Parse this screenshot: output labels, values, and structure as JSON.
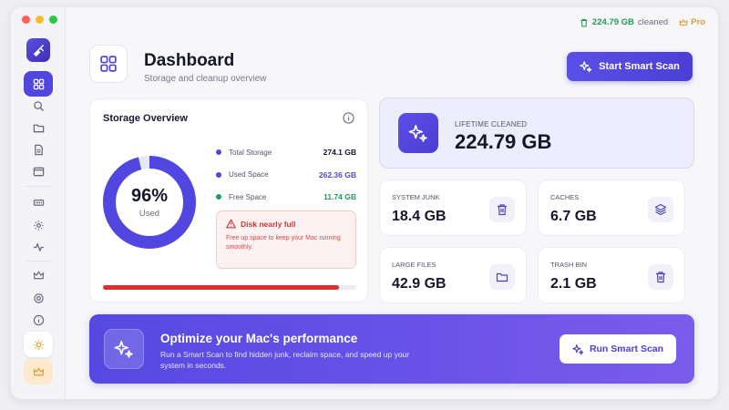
{
  "colors": {
    "accent": "#5146e0",
    "green": "#1f9d55",
    "red": "#e02e2e",
    "orange": "#e89b2b",
    "total_dot": "#5146e0",
    "used_dot": "#5146e0",
    "free_dot": "#1f9d55"
  },
  "topbar": {
    "cleaned_value": "224.79 GB",
    "cleaned_label": "cleaned",
    "pro_label": "Pro"
  },
  "header": {
    "title": "Dashboard",
    "subtitle": "Storage and cleanup overview",
    "scan_button": "Start Smart Scan"
  },
  "storage": {
    "title": "Storage Overview",
    "used_percent": 96,
    "percent_label": "96%",
    "used_label": "Used",
    "legend": [
      {
        "name": "Total Storage",
        "value": "274.1 GB",
        "color": "#16162a"
      },
      {
        "name": "Used Space",
        "value": "262.36 GB",
        "color": "#5146e0"
      },
      {
        "name": "Free Space",
        "value": "11.74 GB",
        "color": "#1f9d55"
      }
    ],
    "warning_title": "Disk nearly full",
    "warning_text": "Free up space to keep your Mac running smoothly.",
    "bar_fraction": 0.93
  },
  "lifetime": {
    "label": "LIFETIME CLEANED",
    "value": "224.79 GB"
  },
  "stats": [
    {
      "label": "SYSTEM JUNK",
      "value": "18.4 GB",
      "icon": "trash-icon"
    },
    {
      "label": "CACHES",
      "value": "6.7 GB",
      "icon": "layers-icon"
    },
    {
      "label": "LARGE FILES",
      "value": "42.9 GB",
      "icon": "folder-icon"
    },
    {
      "label": "TRASH BIN",
      "value": "2.1 GB",
      "icon": "trash-icon"
    }
  ],
  "banner": {
    "title": "Optimize your Mac's performance",
    "text": "Run a Smart Scan to find hidden junk, reclaim space, and speed up your system in seconds.",
    "button": "Run Smart Scan"
  }
}
